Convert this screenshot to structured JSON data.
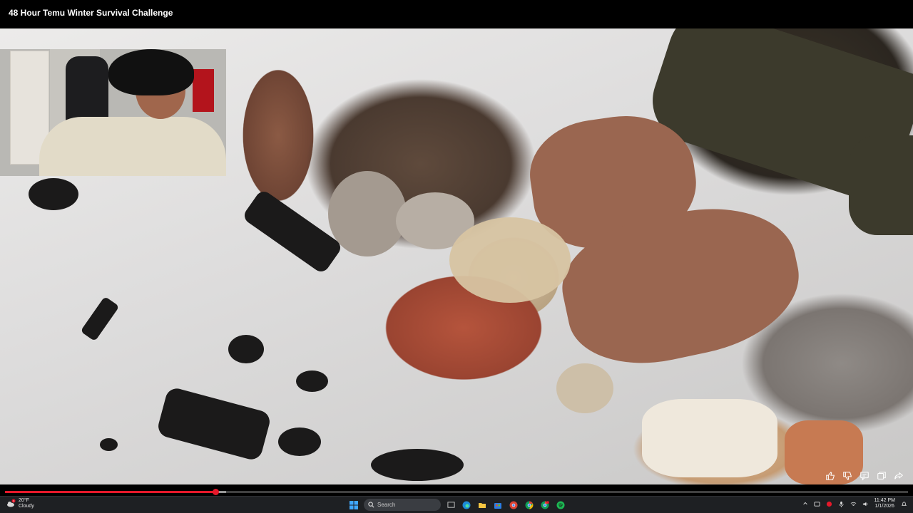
{
  "video": {
    "title": "48 Hour Temu Winter Survival Challenge",
    "progress_percent": 23.3
  },
  "player_controls": {
    "icons": [
      "thumbs-up-icon",
      "thumbs-down-icon",
      "comment-icon",
      "copy-icon",
      "share-icon"
    ]
  },
  "taskbar": {
    "weather": {
      "temperature": "20°F",
      "condition": "Cloudy",
      "badge": "1"
    },
    "search_placeholder": "Search",
    "pinned_apps": [
      "start-icon",
      "task-view-icon",
      "edge-icon",
      "file-explorer-icon",
      "store-icon",
      "chrome-app-icon",
      "chrome-icon",
      "chrome-profile-icon",
      "spotify-icon"
    ],
    "clock": {
      "time": "11:42 PM",
      "date": "1/1/2026"
    }
  },
  "colors": {
    "progress": "#e5182a",
    "taskbar": "#1e2023",
    "spotify": "#1db954"
  }
}
